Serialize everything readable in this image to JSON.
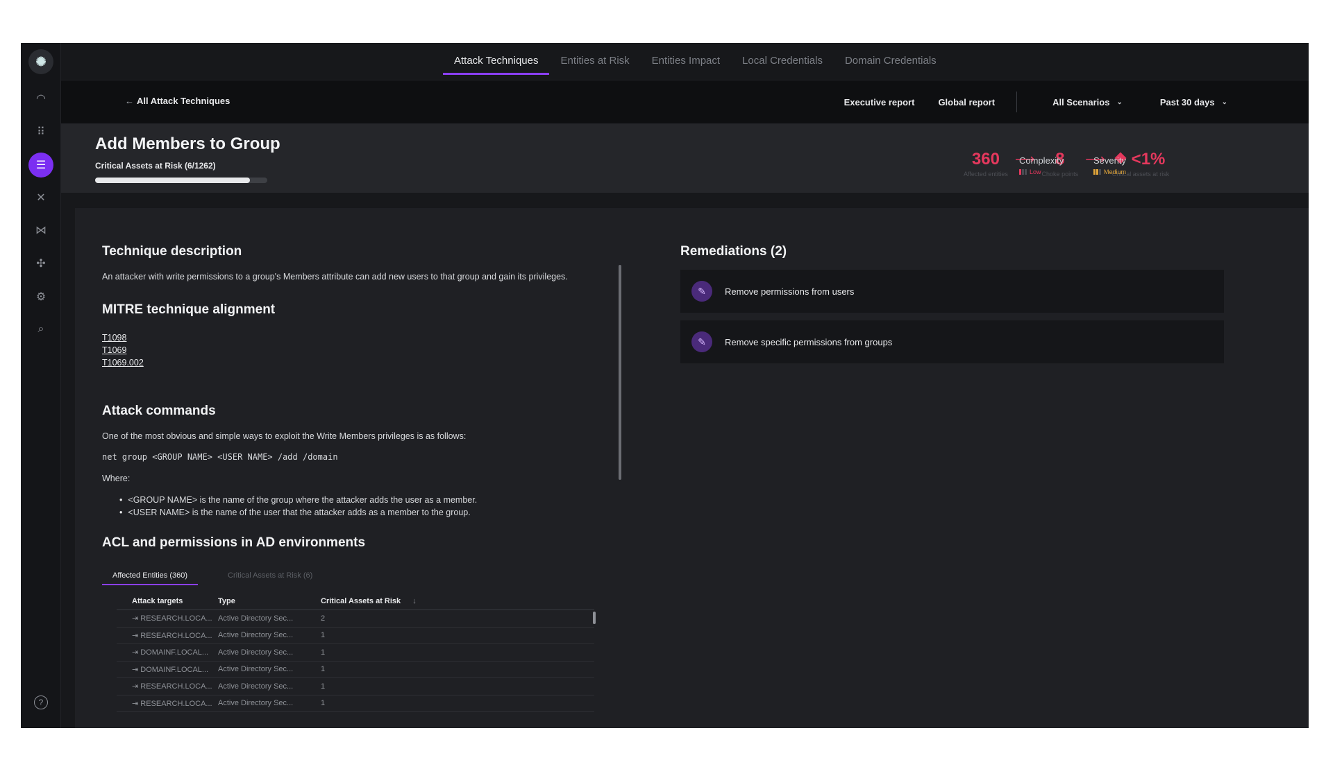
{
  "app": {
    "logo_glyph": "✺"
  },
  "sidebar": {
    "items": [
      {
        "name": "speedometer-icon",
        "glyph": "◠"
      },
      {
        "name": "grid-icon",
        "glyph": "⠿"
      },
      {
        "name": "document-list-icon",
        "glyph": "☰",
        "active": true
      },
      {
        "name": "shuffle-icon",
        "glyph": "✕"
      },
      {
        "name": "route-icon",
        "glyph": "⋈"
      },
      {
        "name": "target-icon",
        "glyph": "✣"
      },
      {
        "name": "settings-icon",
        "glyph": "⚙"
      },
      {
        "name": "search-list-icon",
        "glyph": "⌕"
      }
    ],
    "help_glyph": "?"
  },
  "top_tabs": [
    {
      "label": "Attack Techniques",
      "active": true
    },
    {
      "label": "Entities at Risk"
    },
    {
      "label": "Entities Impact"
    },
    {
      "label": "Local Credentials"
    },
    {
      "label": "Domain Credentials"
    }
  ],
  "subheader": {
    "back_label": "All Attack Techniques",
    "executive_report": "Executive report",
    "global_report": "Global report",
    "scenarios": "All Scenarios",
    "period": "Past 30 days"
  },
  "header": {
    "title": "Add Members to Group",
    "subtitle": "Critical Assets at Risk (6/1262)",
    "progress_fraction": 0.9,
    "metrics": [
      {
        "value": "360",
        "label": "Affected entities"
      },
      {
        "value": "8",
        "label": "Choke points"
      },
      {
        "value": "<1%",
        "label": "Critical assets at risk"
      }
    ],
    "complexity": {
      "name": "Complexity",
      "value": "Low",
      "color": "#e5385d"
    },
    "severity": {
      "name": "Severity",
      "value": "Medium",
      "color": "#e0a43a"
    }
  },
  "technique": {
    "heading": "Technique description",
    "description": "An attacker with write permissions to a group's Members attribute can add new users to that group and gain its privileges."
  },
  "mitre": {
    "heading": "MITRE technique alignment",
    "links": [
      "T1098",
      "T1069",
      "T1069.002"
    ]
  },
  "attack_commands": {
    "heading": "Attack commands",
    "intro": "One of the most obvious and simple ways to exploit the Write Members privileges is as follows:",
    "code": "net group <GROUP NAME> <USER NAME> /add /domain",
    "where": "Where:",
    "bullets": [
      "<GROUP NAME> is the name of the group where the attacker adds the user as a member.",
      "<USER NAME> is the name of the user that the attacker adds as a member to the group."
    ]
  },
  "acl": {
    "heading": "ACL and permissions in AD environments",
    "tabs": [
      {
        "label": "Affected Entities (360)",
        "active": true
      },
      {
        "label": "Critical Assets at Risk (6)"
      }
    ],
    "columns": [
      "Attack targets",
      "Type",
      "Critical Assets at Risk"
    ],
    "sort_glyph": "↓",
    "rows": [
      {
        "target": "RESEARCH.LOCA...",
        "type": "Active Directory Sec...",
        "count": "2"
      },
      {
        "target": "RESEARCH.LOCA...",
        "type": "Active Directory Sec...",
        "count": "1"
      },
      {
        "target": "DOMAINF.LOCAL...",
        "type": "Active Directory Sec...",
        "count": "1"
      },
      {
        "target": "DOMAINF.LOCAL...",
        "type": "Active Directory Sec...",
        "count": "1"
      },
      {
        "target": "RESEARCH.LOCA...",
        "type": "Active Directory Sec...",
        "count": "1"
      },
      {
        "target": "RESEARCH.LOCA...",
        "type": "Active Directory Sec...",
        "count": "1"
      }
    ]
  },
  "remediations": {
    "heading": "Remediations (2)",
    "items": [
      {
        "label": "Remove permissions from users"
      },
      {
        "label": "Remove specific permissions from groups"
      }
    ]
  }
}
